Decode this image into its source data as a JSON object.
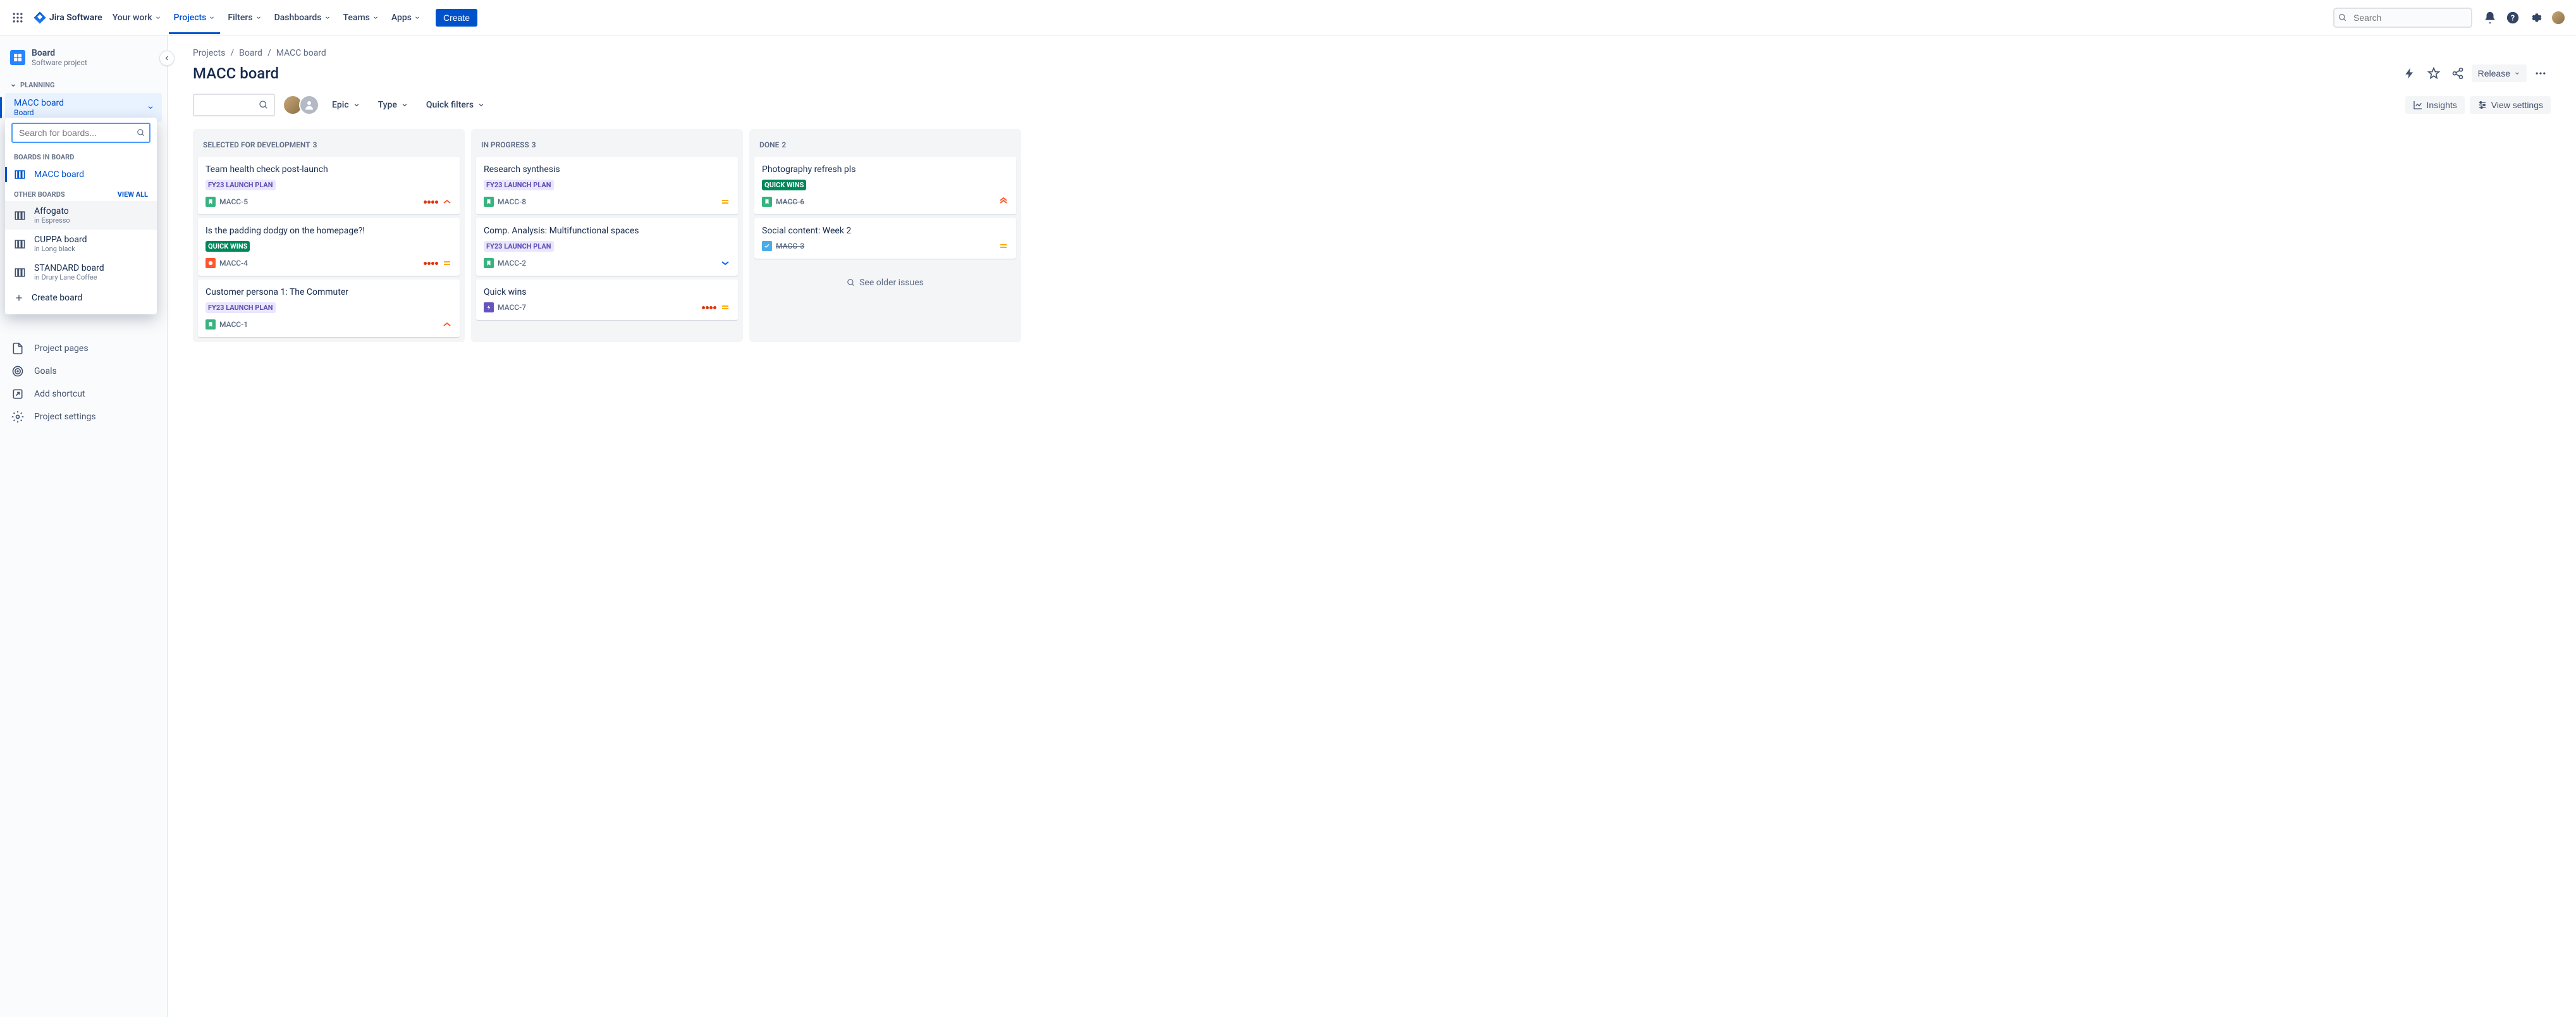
{
  "nav": {
    "logo": "Jira Software",
    "items": [
      "Your work",
      "Projects",
      "Filters",
      "Dashboards",
      "Teams",
      "Apps"
    ],
    "active": 1,
    "create": "Create",
    "search_placeholder": "Search"
  },
  "sidebar": {
    "project_name": "Board",
    "project_type": "Software project",
    "planning_label": "PLANNING",
    "selected_board": {
      "name": "MACC board",
      "sub": "Board"
    },
    "bottom_items": [
      "Project pages",
      "Goals",
      "Add shortcut",
      "Project settings"
    ]
  },
  "board_dropdown": {
    "search_placeholder": "Search for boards...",
    "section1_label": "BOARDS IN BOARD",
    "boards_in_project": [
      "MACC board"
    ],
    "section2_label": "OTHER BOARDS",
    "view_all": "VIEW ALL",
    "other_boards": [
      {
        "name": "Affogato",
        "sub": "in Espresso"
      },
      {
        "name": "CUPPA board",
        "sub": "in Long black"
      },
      {
        "name": "STANDARD board",
        "sub": "in Drury Lane Coffee"
      }
    ],
    "create_label": "Create board"
  },
  "breadcrumbs": [
    "Projects",
    "Board",
    "MACC board"
  ],
  "page_title": "MACC board",
  "release_label": "Release",
  "toolbar": {
    "filters": [
      "Epic",
      "Type",
      "Quick filters"
    ],
    "insights": "Insights",
    "view_settings": "View settings"
  },
  "columns": [
    {
      "name": "SELECTED FOR DEVELOPMENT",
      "count": 3,
      "cards": [
        {
          "title": "Team health check post-launch",
          "lozenge": "FY23 LAUNCH PLAN",
          "lz_class": "lz-purple",
          "type": "story",
          "key": "MACC-5",
          "dots": true,
          "prio": "high"
        },
        {
          "title": "Is the padding dodgy on the homepage?!",
          "lozenge": "QUICK WINS",
          "lz_class": "lz-teal",
          "type": "bug",
          "key": "MACC-4",
          "dots": true,
          "prio": "medium"
        },
        {
          "title": "Customer persona 1: The Commuter",
          "lozenge": "FY23 LAUNCH PLAN",
          "lz_class": "lz-purple",
          "type": "story",
          "key": "MACC-1",
          "prio": "high"
        }
      ]
    },
    {
      "name": "IN PROGRESS",
      "count": 3,
      "cards": [
        {
          "title": "Research synthesis",
          "lozenge": "FY23 LAUNCH PLAN",
          "lz_class": "lz-purple",
          "type": "story",
          "key": "MACC-8",
          "prio": "medium"
        },
        {
          "title": "Comp. Analysis: Multifunctional spaces",
          "lozenge": "FY23 LAUNCH PLAN",
          "lz_class": "lz-purple",
          "type": "story",
          "key": "MACC-2",
          "prio": "low"
        },
        {
          "title": "Quick wins",
          "type": "epic",
          "key": "MACC-7",
          "dots": true,
          "prio": "medium"
        }
      ]
    },
    {
      "name": "DONE",
      "count": 2,
      "cards": [
        {
          "title": "Photography refresh pls",
          "lozenge": "QUICK WINS",
          "lz_class": "lz-teal",
          "type": "story",
          "key": "MACC-6",
          "strike": true,
          "prio": "highest"
        },
        {
          "title": "Social content: Week 2",
          "type": "task",
          "key": "MACC-3",
          "strike": true,
          "prio": "medium"
        }
      ],
      "see_older": "See older issues"
    }
  ]
}
